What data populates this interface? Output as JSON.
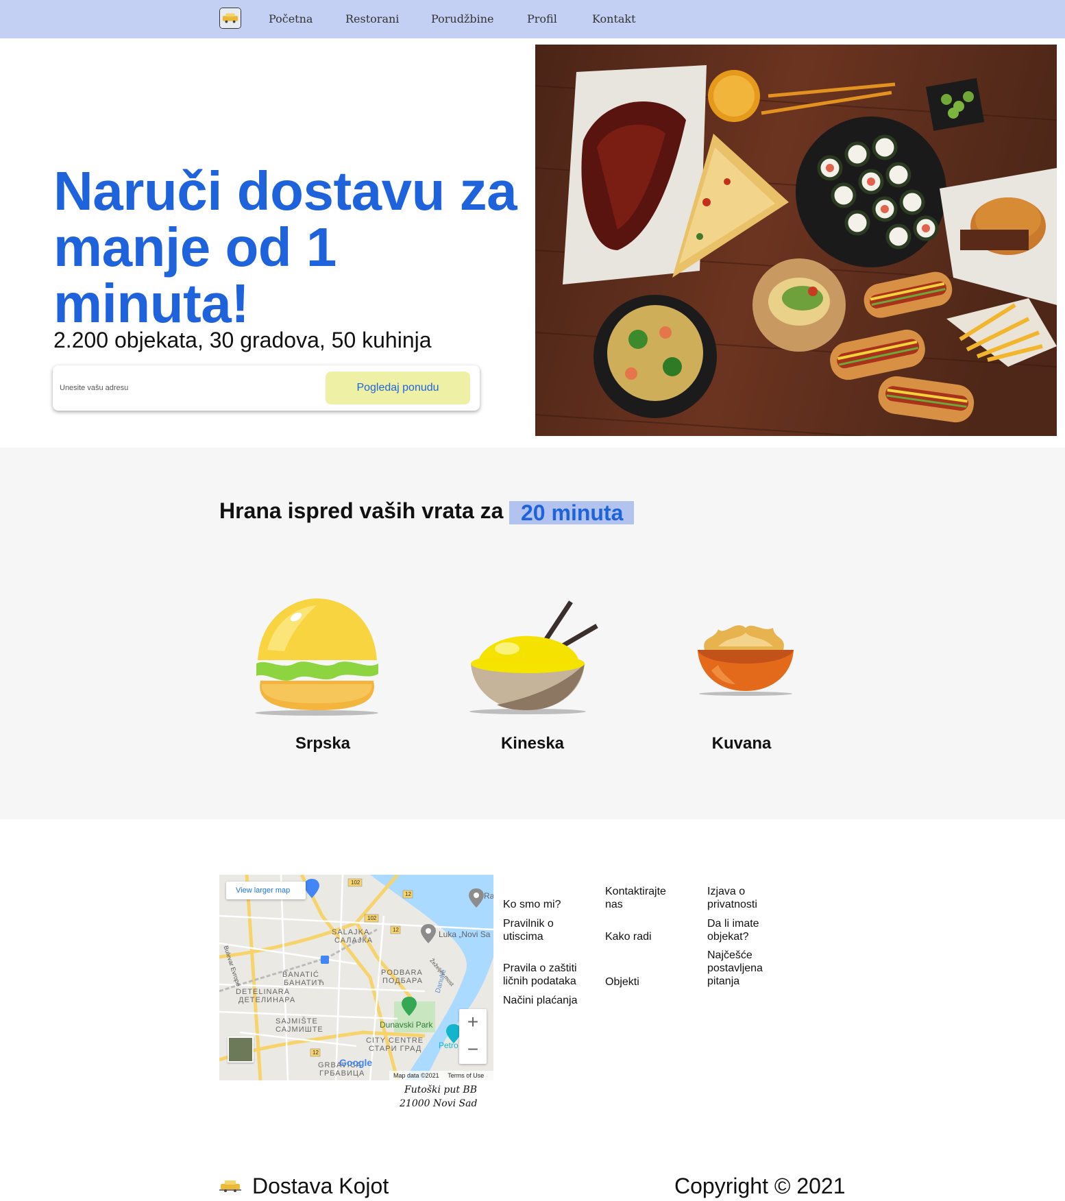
{
  "nav": {
    "logo_icon": "taxi-logo-icon",
    "items": [
      "Početna",
      "Restorani",
      "Porudžbine",
      "Profil",
      "Kontakt"
    ]
  },
  "hero": {
    "title": "Naruči dostavu za manje od 1 minuta!",
    "subtitle": "2.200 objekata, 30 gradova, 50 kuhinja",
    "address_placeholder": "Unesite vašu adresu",
    "button_label": "Pogledaj ponudu",
    "image": "food-spread-photo"
  },
  "cuisines": {
    "heading": "Hrana ispred vaših vrata za",
    "highlight": "20 minuta",
    "items": [
      {
        "label": "Srpska",
        "icon": "burger-icon"
      },
      {
        "label": "Kineska",
        "icon": "noodle-bowl-icon"
      },
      {
        "label": "Kuvana",
        "icon": "stew-bowl-icon"
      }
    ]
  },
  "map": {
    "larger_map_label": "View larger map",
    "credit": "Map data ©2021",
    "terms": "Terms of Use",
    "google": "Google",
    "zoom_in": "+",
    "zoom_out": "−",
    "labels": [
      "SALAJKA",
      "САЛАЈКА",
      "BANATIĆ",
      "БАНАТИЋ",
      "DETELINARA",
      "ДЕТЕЛИНАРА",
      "SAJMIŠTE",
      "САЈМИШТЕ",
      "PODBARA",
      "ПОДБАРА",
      "CITY CENTRE",
      "СТАРИ ГРАД",
      "GRBAVICA",
      "ГРБАВИЦА",
      "Dunavski Park",
      "Luka „Novi Sa",
      "Petro",
      "Ra",
      "Danube",
      "Žeželjev most",
      "Bulevar Evrope",
      "102",
      "12"
    ]
  },
  "address": {
    "line1": "Futoški put BB",
    "line2": "21000 Novi Sad"
  },
  "footer_links": {
    "col1": [
      "Ko smo mi?",
      "Pravilnik o utiscima",
      "Pravila o zaštiti ličnih podataka",
      "Načini plaćanja"
    ],
    "col2": [
      "Kontaktirajte nas",
      "Kako radi",
      "Objekti"
    ],
    "col3": [
      "Izjava o privatnosti",
      "Da li imate objekat?",
      "Najčešće postavljena pitanja"
    ]
  },
  "footer": {
    "brand": "Dostava Kojot",
    "copyright": "Copyright © 2021"
  },
  "colors": {
    "nav_bg": "#c3d0f3",
    "accent_blue": "#1e63dc",
    "button_bg": "#eef0a6",
    "highlight_bg": "#b2c3ef",
    "section_bg": "#f6f6f6"
  }
}
